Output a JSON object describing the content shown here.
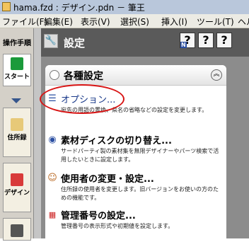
{
  "window": {
    "title": "hama.fzd : デザイン.pdn － 筆王"
  },
  "menu": [
    "ファイル(F)",
    "編集(E)",
    "表示(V)",
    "選択(S)",
    "挿入(I)",
    "ツール(T)",
    "ヘル"
  ],
  "left_panel": {
    "header": "操作手順",
    "start_label": "スタート",
    "address_label": "住所録",
    "design_label": "デザイン"
  },
  "settings": {
    "title": "設定",
    "help_buttons": [
      "?",
      "?",
      "?"
    ],
    "help_n_badge": "N"
  },
  "card": {
    "title": "各種設定",
    "items": [
      {
        "title": "オプション...",
        "description": "宛先の用語の置換、県名の省略などの設定を変更します。",
        "icon": "list-icon"
      },
      {
        "title": "素材ディスクの切り替え...",
        "description": "サードパーティ製の素材集を無限デザイナーやパーツ検索で活用したいときに設定します。",
        "icon": "disk-icon"
      },
      {
        "title": "使用者の変更・設定...",
        "description": "住所録の使用者を変更します。旧バージョンをお使いの方のための機能です。",
        "icon": "user-icon"
      },
      {
        "title": "管理番号の設定...",
        "description": "管理番号の表示形式や初期値を設定します。",
        "icon": "number-grid-icon"
      }
    ]
  },
  "colors": {
    "titlebar": "#b9c7db",
    "settings_bar": "#5a5a5a",
    "highlight": "#d81414"
  }
}
